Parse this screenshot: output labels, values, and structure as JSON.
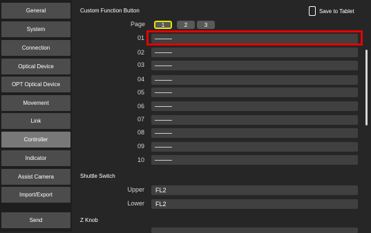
{
  "sidebar": {
    "items": [
      {
        "label": "General"
      },
      {
        "label": "System"
      },
      {
        "label": "Connection"
      },
      {
        "label": "Optical Device"
      },
      {
        "label": "OPT Optical Device"
      },
      {
        "label": "Movement"
      },
      {
        "label": "Link"
      },
      {
        "label": "Controller"
      },
      {
        "label": "Indicator"
      },
      {
        "label": "Assist Camera"
      },
      {
        "label": "Import/Export"
      }
    ],
    "active": "Controller",
    "send_label": "Send"
  },
  "custom_function": {
    "title": "Custom Function Button",
    "save_label": "Save to Tablet",
    "page_label": "Page",
    "pages": [
      "1",
      "2",
      "3"
    ],
    "selected_page": "1",
    "rows": [
      {
        "num": "01",
        "value": "———"
      },
      {
        "num": "02",
        "value": "———"
      },
      {
        "num": "03",
        "value": "———"
      },
      {
        "num": "04",
        "value": "———"
      },
      {
        "num": "05",
        "value": "———"
      },
      {
        "num": "06",
        "value": "———"
      },
      {
        "num": "07",
        "value": "———"
      },
      {
        "num": "08",
        "value": "———"
      },
      {
        "num": "09",
        "value": "———"
      },
      {
        "num": "10",
        "value": "———"
      }
    ]
  },
  "shuttle_switch": {
    "title": "Shuttle Switch",
    "upper_label": "Upper",
    "upper_value": "FL2",
    "lower_label": "Lower",
    "lower_value": "FL2"
  },
  "z_knob": {
    "title": "Z Knob"
  },
  "colors": {
    "highlight": "#e60000",
    "selected_page_border": "#e6e600"
  }
}
